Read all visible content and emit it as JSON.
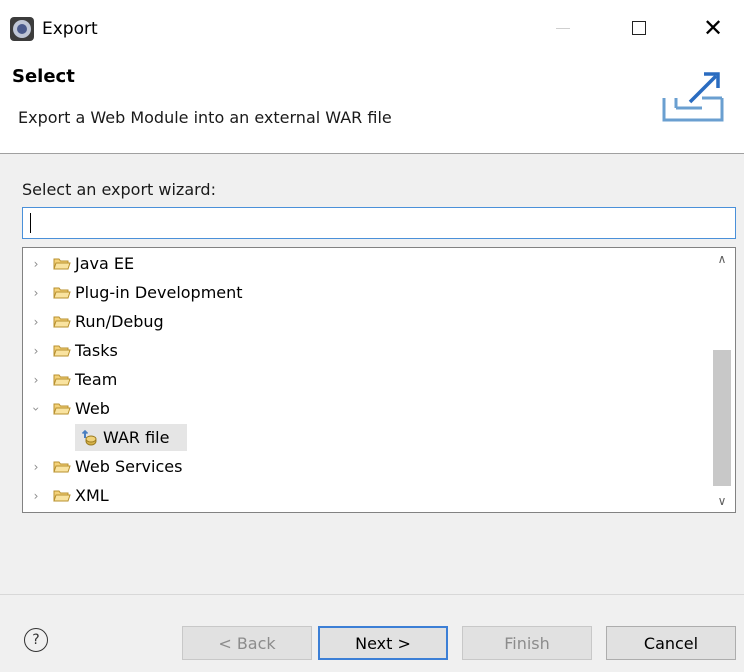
{
  "window": {
    "title": "Export"
  },
  "banner": {
    "title": "Select",
    "description": "Export a Web Module into an external WAR file"
  },
  "wizard": {
    "label": "Select an export wizard:",
    "filter_value": ""
  },
  "tree": {
    "items": [
      {
        "label": "Java EE",
        "expanded": false,
        "level": 0,
        "icon": "folder-icon"
      },
      {
        "label": "Plug-in Development",
        "expanded": false,
        "level": 0,
        "icon": "folder-icon"
      },
      {
        "label": "Run/Debug",
        "expanded": false,
        "level": 0,
        "icon": "folder-icon"
      },
      {
        "label": "Tasks",
        "expanded": false,
        "level": 0,
        "icon": "folder-icon"
      },
      {
        "label": "Team",
        "expanded": false,
        "level": 0,
        "icon": "folder-icon"
      },
      {
        "label": "Web",
        "expanded": true,
        "level": 0,
        "icon": "folder-icon"
      },
      {
        "label": "WAR file",
        "level": 1,
        "selected": true,
        "icon": "war-file-icon"
      },
      {
        "label": "Web Services",
        "expanded": false,
        "level": 0,
        "icon": "folder-icon"
      },
      {
        "label": "XML",
        "expanded": false,
        "level": 0,
        "icon": "folder-icon"
      }
    ]
  },
  "buttons": {
    "help": "?",
    "back": "< Back",
    "next": "Next >",
    "finish": "Finish",
    "cancel": "Cancel"
  },
  "colors": {
    "accent": "#3c7fd6",
    "folder": "#e8c15a"
  }
}
